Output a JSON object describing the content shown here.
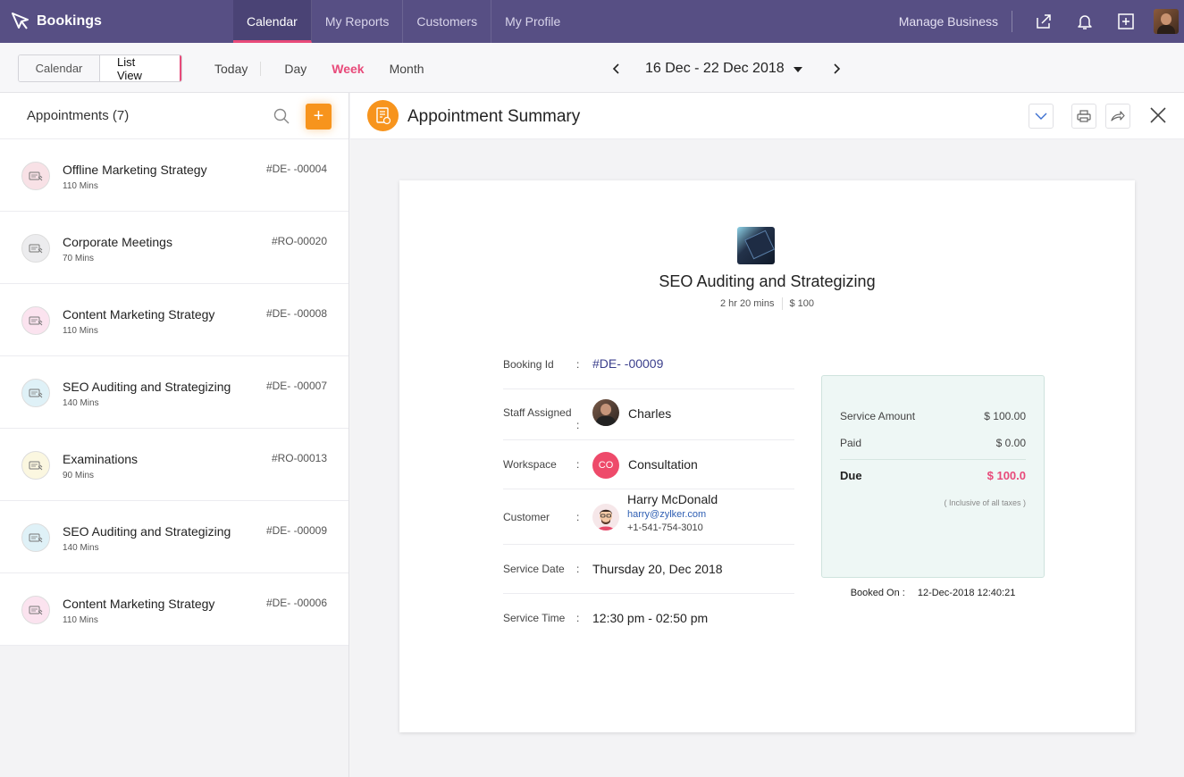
{
  "app": {
    "name": "Bookings"
  },
  "nav": {
    "tabs": [
      {
        "label": "Calendar",
        "active": true
      },
      {
        "label": "My Reports"
      },
      {
        "label": "Customers"
      },
      {
        "label": "My Profile"
      }
    ],
    "manage_business": "Manage Business"
  },
  "toolbar": {
    "segment": [
      "Calendar",
      "List View"
    ],
    "today": "Today",
    "views": [
      "Day",
      "Week",
      "Month"
    ],
    "date_range": "16 Dec - 22 Dec 2018"
  },
  "appointments": {
    "title": "Appointments (7)",
    "items": [
      {
        "name": "Offline Marketing Strategy",
        "duration": "110 Mins",
        "id": "#DE- -00004",
        "color": "#f8e1e6"
      },
      {
        "name": "Corporate Meetings",
        "duration": "70 Mins",
        "id": "#RO-00020",
        "color": "#ececee"
      },
      {
        "name": "Content Marketing Strategy",
        "duration": "110 Mins",
        "id": "#DE- -00008",
        "color": "#fbe3ef"
      },
      {
        "name": "SEO Auditing and Strategizing",
        "duration": "140 Mins",
        "id": "#DE- -00007",
        "color": "#dff1f7"
      },
      {
        "name": "Examinations",
        "duration": "90 Mins",
        "id": "#RO-00013",
        "color": "#fbf7e0"
      },
      {
        "name": "SEO Auditing and Strategizing",
        "duration": "140 Mins",
        "id": "#DE- -00009",
        "color": "#dff1f7"
      },
      {
        "name": "Content Marketing Strategy",
        "duration": "110 Mins",
        "id": "#DE- -00006",
        "color": "#fbe3ef"
      }
    ]
  },
  "summary": {
    "title": "Appointment Summary",
    "service": {
      "name": "SEO Auditing and Strategizing",
      "duration": "2 hr 20 mins",
      "price": "$ 100"
    },
    "booking_id": {
      "label": "Booking Id",
      "value": "#DE- -00009"
    },
    "staff": {
      "label": "Staff Assigned",
      "value": "Charles"
    },
    "workspace": {
      "label": "Workspace",
      "value": "Consultation",
      "initials": "CO"
    },
    "customer": {
      "label": "Customer",
      "name": "Harry McDonald",
      "email": "harry@zylker.com",
      "phone": "+1-541-754-3010"
    },
    "service_date": {
      "label": "Service Date",
      "value": "Thursday 20, Dec 2018"
    },
    "service_time": {
      "label": "Service Time",
      "value": "12:30 pm - 02:50 pm"
    },
    "payment": {
      "service_amount_label": "Service Amount",
      "service_amount": "$ 100.00",
      "paid_label": "Paid",
      "paid": "$ 0.00",
      "due_label": "Due",
      "due": "$ 100.0",
      "note": "( Inclusive of all taxes )"
    },
    "booked_on": {
      "label": "Booked On :",
      "value": "12-Dec-2018 12:40:21"
    }
  },
  "colors": {
    "topbar": "#574f84",
    "accent": "#e84a7a",
    "orange": "#f7941d"
  }
}
